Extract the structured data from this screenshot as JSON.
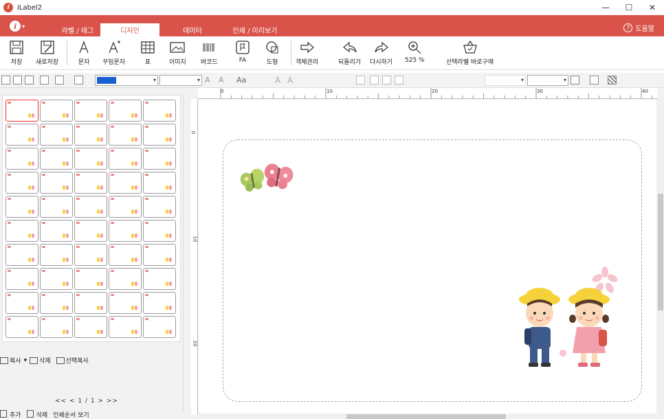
{
  "window": {
    "title": "iLabel2"
  },
  "menu": {
    "tabs": [
      {
        "label": "라벨 / 태그"
      },
      {
        "label": "디자인"
      },
      {
        "label": "데이터"
      },
      {
        "label": "인쇄 / 미리보기"
      }
    ],
    "help": "도움말"
  },
  "ribbon": {
    "items": [
      {
        "label": "저장",
        "icon": "save-icon"
      },
      {
        "label": "새로저장",
        "icon": "save-as-icon"
      },
      {
        "label": "문자",
        "icon": "text-icon"
      },
      {
        "label": "꾸밈문자",
        "icon": "fancy-text-icon"
      },
      {
        "label": "표",
        "icon": "table-icon"
      },
      {
        "label": "이미지",
        "icon": "image-icon"
      },
      {
        "label": "바코드",
        "icon": "barcode-icon"
      },
      {
        "label": "FA",
        "icon": "fa-icon"
      },
      {
        "label": "도형",
        "icon": "shape-icon"
      },
      {
        "label": "객체관리",
        "icon": "object-manage-icon"
      },
      {
        "label": "되돌리기",
        "icon": "undo-icon"
      },
      {
        "label": "다시하기",
        "icon": "redo-icon"
      },
      {
        "label": "525 %",
        "icon": "zoom-icon"
      },
      {
        "label": "선택라벨 바로구매",
        "icon": "basket-icon"
      }
    ]
  },
  "ruler": {
    "top_labels": [
      "0",
      "10",
      "20",
      "30",
      "40"
    ],
    "left_labels": [
      "0",
      "10",
      "20"
    ]
  },
  "left_panel": {
    "copy": "복사",
    "delete": "삭제",
    "select_copy": "선택복사",
    "nav": "<<   <    1 / 1    >   >>",
    "add": "추가",
    "remove": "삭제",
    "print_order": "인쇄순서 보기"
  },
  "colors": {
    "accent": "#d9534a",
    "selected_thumb": "#ee3333"
  }
}
